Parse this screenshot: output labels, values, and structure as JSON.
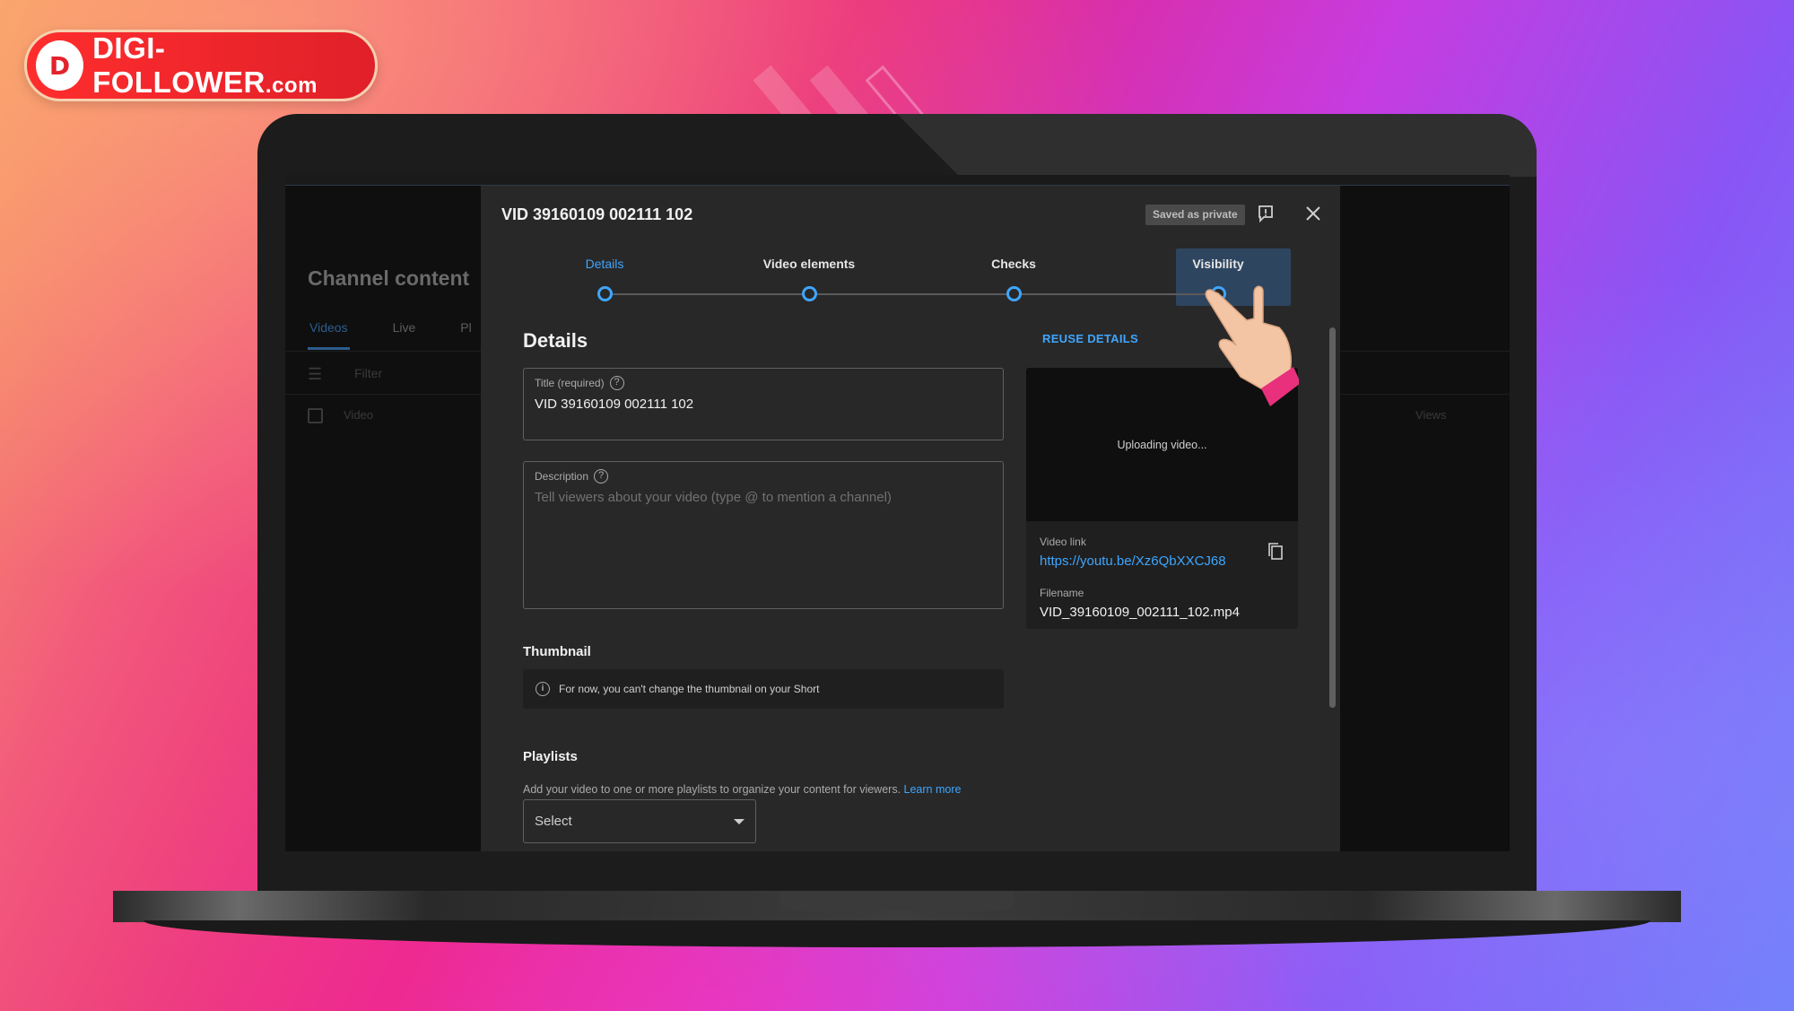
{
  "brand": {
    "logo_mark": "D",
    "logo_text": "DIGI-FOLLOWER",
    "logo_suffix": ".com"
  },
  "studio": {
    "title": "Channel content",
    "tabs": [
      {
        "label": "Videos",
        "active": true
      },
      {
        "label": "Live",
        "active": false
      },
      {
        "label": "Pl",
        "active": false
      }
    ],
    "filter_placeholder": "Filter",
    "columns": {
      "video": "Video",
      "views": "Views"
    }
  },
  "dialog": {
    "title": "VID 39160109 002111 102",
    "status_badge": "Saved as private",
    "steps": [
      {
        "label": "Details",
        "active": true
      },
      {
        "label": "Video elements",
        "active": false
      },
      {
        "label": "Checks",
        "active": false
      },
      {
        "label": "Visibility",
        "active": false,
        "highlighted": true
      }
    ],
    "section_title": "Details",
    "reuse_label": "REUSE DETAILS",
    "title_field": {
      "label": "Title (required)",
      "value": "VID 39160109 002111 102"
    },
    "description_field": {
      "label": "Description",
      "placeholder": "Tell viewers about your video (type @ to mention a channel)"
    },
    "thumbnail": {
      "heading": "Thumbnail",
      "note": "For now, you can't change the thumbnail on your Short"
    },
    "playlists": {
      "heading": "Playlists",
      "description": "Add your video to one or more playlists to organize your content for viewers.",
      "learn_more": "Learn more",
      "select_value": "Select"
    },
    "preview": {
      "status": "Uploading video...",
      "video_link_label": "Video link",
      "video_link": "https://youtu.be/Xz6QbXXCJ68",
      "filename_label": "Filename",
      "filename": "VID_39160109_002111_102.mp4"
    }
  },
  "colors": {
    "accent": "#3ea6ff",
    "dialog_bg": "#282828",
    "page_bg": "#0f0f0f",
    "brand_red": "#e3232c"
  },
  "icons": [
    "feedback-icon",
    "close-icon",
    "help-icon",
    "info-icon",
    "copy-icon",
    "caret-down-icon",
    "filter-icon",
    "pointing-hand-icon"
  ]
}
